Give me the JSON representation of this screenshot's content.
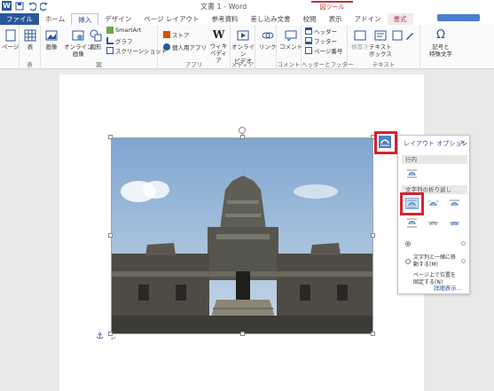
{
  "titlebar": {
    "logo": "W",
    "document_title": "文書 1 - Word",
    "context_tool_label": "図ツール"
  },
  "tabs": [
    {
      "label": "ファイル",
      "kind": "file"
    },
    {
      "label": "ホーム",
      "kind": "normal"
    },
    {
      "label": "挿入",
      "kind": "active"
    },
    {
      "label": "デザイン",
      "kind": "normal"
    },
    {
      "label": "ページ レイアウト",
      "kind": "normal"
    },
    {
      "label": "参考資料",
      "kind": "normal"
    },
    {
      "label": "差し込み文書",
      "kind": "normal"
    },
    {
      "label": "校閲",
      "kind": "normal"
    },
    {
      "label": "表示",
      "kind": "normal"
    },
    {
      "label": "アドイン",
      "kind": "normal"
    },
    {
      "label": "書式",
      "kind": "context"
    }
  ],
  "ribbon": {
    "pages": {
      "button": "ページ",
      "group": ""
    },
    "table": {
      "button": "表",
      "group": "表"
    },
    "illustrations": {
      "group": "図",
      "picture": "画像",
      "online_picture": "オンライン\n画像",
      "shapes": "図形",
      "smartart": "SmartArt",
      "chart": "グラフ",
      "screenshot": "スクリーンショット"
    },
    "apps": {
      "group": "アプリ",
      "store": "ストア",
      "my_apps": "個人用アプリ",
      "wikipedia": "ウィキ\nペディア"
    },
    "media": {
      "group": "メディア",
      "online_video": "オンライン\nビデオ"
    },
    "links": {
      "button": "リンク"
    },
    "comments": {
      "group": "コメント",
      "button": "コメント"
    },
    "header_footer": {
      "group": "ヘッダーとフッター",
      "header": "ヘッダー",
      "footer": "フッター",
      "page_number": "ページ番号"
    },
    "text": {
      "group": "テキスト",
      "textbox": "テキスト\nボックス",
      "vertical": "横書き"
    },
    "symbols": {
      "button": "記号と\n特殊文字"
    }
  },
  "layout_options": {
    "title": "レイアウト オプション",
    "close": "×",
    "inline_label": "行内",
    "wrap_label": "文字列の折り返し",
    "option_move_with_text": "文字列と一緒に移\n動する(M)",
    "option_fix_position": "ページ上で位置を\n固定する(N)",
    "see_more": "詳細表示..."
  },
  "icons": {
    "layout_trigger": "layout-options-icon",
    "anchor": "anchor-icon",
    "paragraph": "paragraph-mark-icon"
  },
  "glyphs": {
    "anchor": "⚓",
    "paragraph": "↵"
  },
  "colors": {
    "accent": "#2b579a",
    "file_tab": "#2b579a",
    "highlight_red": "#d6232f",
    "context_tab": "#9a3f52"
  }
}
